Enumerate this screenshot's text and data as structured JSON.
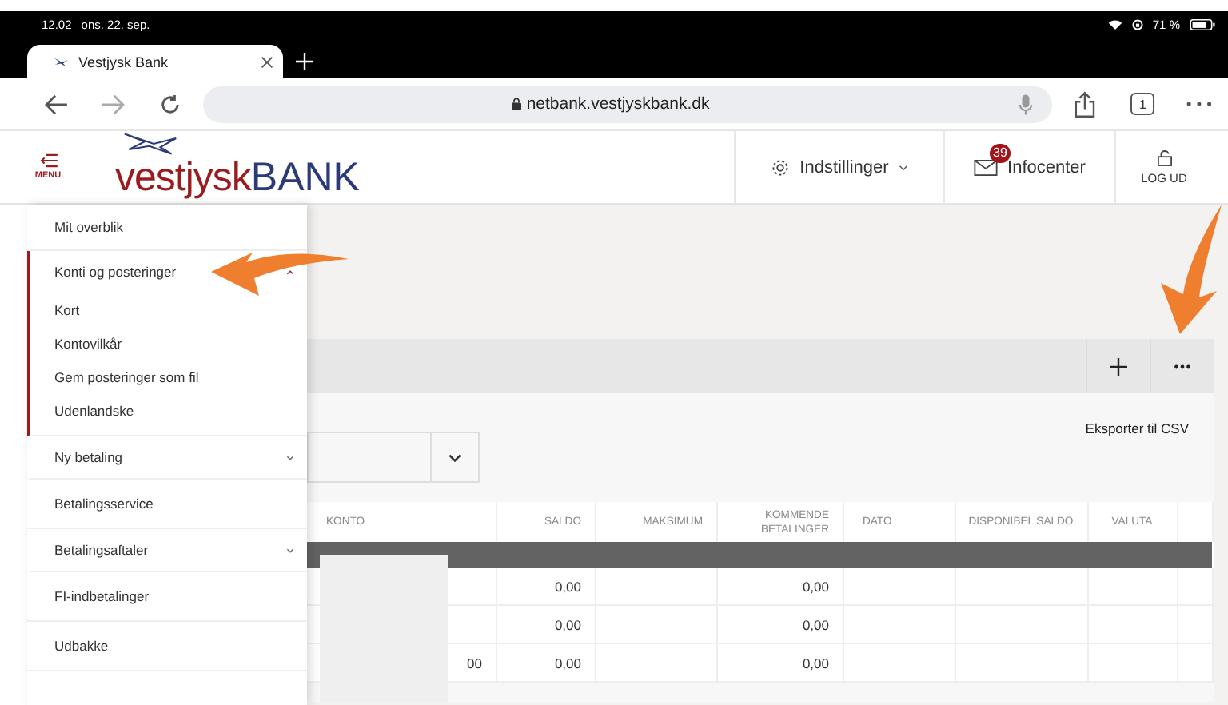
{
  "status_bar": {
    "time": "12.02",
    "date": "ons. 22. sep.",
    "battery": "71 %"
  },
  "browser": {
    "tab_title": "Vestjysk Bank",
    "url": "netbank.vestjyskbank.dk",
    "tab_count": "1"
  },
  "header": {
    "menu_label": "MENU",
    "logo_word": "vestjysk",
    "logo_bank": "BANK",
    "settings": "Indstillinger",
    "infocenter": "Infocenter",
    "badge": "39",
    "logout": "LOG UD"
  },
  "sidebar": {
    "items": [
      {
        "label": "Mit overblik",
        "kind": "link"
      },
      {
        "label": "Konti og posteringer",
        "kind": "group",
        "expanded": true,
        "children": [
          {
            "label": "Kort"
          },
          {
            "label": "Kontovilkår"
          },
          {
            "label": "Gem posteringer som fil"
          },
          {
            "label": "Udenlandske"
          }
        ]
      },
      {
        "label": "Ny betaling",
        "kind": "group",
        "expanded": false
      },
      {
        "label": "Betalingsservice",
        "kind": "link"
      },
      {
        "label": "Betalingsaftaler",
        "kind": "group",
        "expanded": false
      },
      {
        "label": "FI-indbetalinger",
        "kind": "link"
      },
      {
        "label": "Udbakke",
        "kind": "link"
      }
    ]
  },
  "panel": {
    "export": "Eksporter til CSV",
    "columns": [
      "KONTO",
      "SALDO",
      "MAKSIMUM",
      "KOMMENDE BETALINGER",
      "DATO",
      "DISPONIBEL SALDO",
      "VALUTA"
    ],
    "rows": [
      {
        "saldo": "0,00",
        "kommende_betalinger": "0,00"
      },
      {
        "saldo": "0,00",
        "kommende_betalinger": "0,00"
      },
      {
        "konto": "00",
        "saldo": "0,00",
        "kommende_betalinger": "0,00"
      }
    ]
  }
}
